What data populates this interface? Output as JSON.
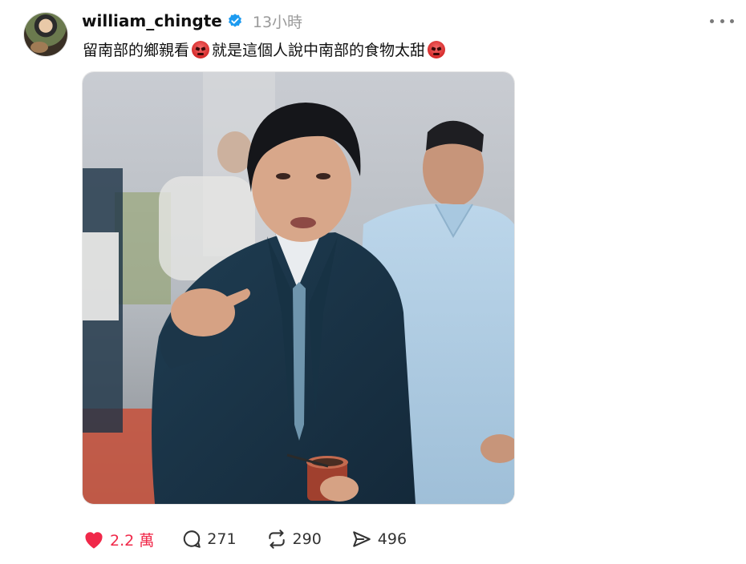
{
  "post": {
    "username": "william_chingte",
    "time": "13小時",
    "caption_part1": "留南部的鄉親看",
    "caption_part2": "就是這個人說中南部的食物太甜",
    "caption_emoji": "😡"
  },
  "actions": {
    "likes": "2.2 萬",
    "replies": "271",
    "reposts": "290",
    "shares": "496"
  },
  "colors": {
    "like_red": "#f02849",
    "verified_blue": "#1d9bf0",
    "muted": "#9a9a9a"
  },
  "icons": [
    "verified-badge-icon",
    "more-options-icon",
    "angry-face-emoji-icon",
    "heart-icon",
    "reply-icon",
    "repost-icon",
    "share-icon"
  ]
}
